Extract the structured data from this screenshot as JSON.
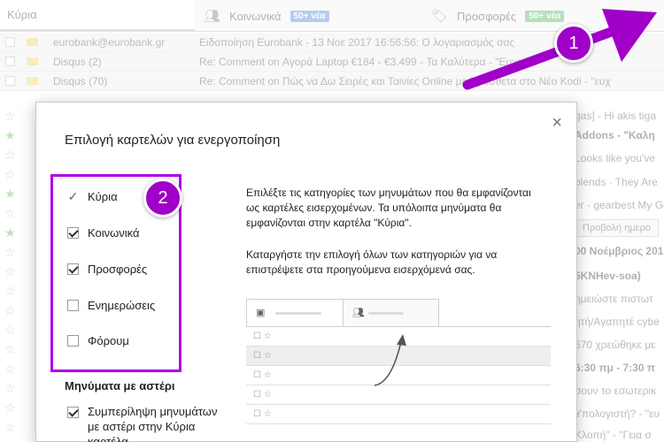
{
  "inbox": {
    "tabs": [
      {
        "label": "Κύρια",
        "badge": ""
      },
      {
        "label": "Κοινωνικά",
        "badge": "50+ νέα"
      },
      {
        "label": "Προσφορές",
        "badge": "50+ νέα"
      }
    ],
    "add_tab": "+",
    "rows": [
      {
        "sender": "eurobank@eurobank.gr",
        "subject": "Ειδοποίηση Eurobank - 13 Νοε 2017 16:56:56: Ο λογαριασμός σας",
        "right": ""
      },
      {
        "sender": "Disqus (2)",
        "subject": "Re: Comment on Αγορά Laptop €184 - €3.499 - Τα Καλύτερα - \"Ευχαρισ",
        "right": ""
      },
      {
        "sender": "Disqus (70)",
        "subject": "Re: Comment on Πώς να Δω Σειρές και Ταινίες Online με Πρόσθετα στο Νέο Kodi - \"ευχ",
        "right": ""
      }
    ],
    "right_snippets": [
      {
        "text": "gas] - Hi akis tiga",
        "style": "normal"
      },
      {
        "text": "Addons - \"Καλη",
        "style": "bold"
      },
      {
        "text": "Looks like you've",
        "style": "normal"
      },
      {
        "text": "blends · They Are",
        "style": "normal"
      },
      {
        "text": "er - gearbest My Ge",
        "style": "normal"
      },
      {
        "text": "Προβολή ημερο",
        "style": "btn"
      },
      {
        "text": "00 Νοέμβριος 201",
        "style": "bold"
      },
      {
        "text": "5KNHev-soa)",
        "style": "bold"
      },
      {
        "text": "ημειώστε πιστωτ",
        "style": "normal"
      },
      {
        "text": "ητή/Αγαπητέ cybe",
        "style": "normal"
      },
      {
        "text": "670 χρεώθηκε με",
        "style": "normal"
      },
      {
        "text": "6:30 πμ - 7:30 π",
        "style": "bold"
      },
      {
        "text": "σουν το εσωτερικ",
        "style": "normal"
      },
      {
        "text": "Υπολογιστή? - \"ευ",
        "style": "normal"
      },
      {
        "text": "Κλοπή\" - \"Γεια σ",
        "style": "normal"
      }
    ]
  },
  "dialog": {
    "title": "Επιλογή καρτελών για ενεργοποίηση",
    "close": "×",
    "options": [
      {
        "label": "Κύρια",
        "state": "fixed"
      },
      {
        "label": "Κοινωνικά",
        "state": "checked"
      },
      {
        "label": "Προσφορές",
        "state": "checked"
      },
      {
        "label": "Ενημερώσεις",
        "state": "unchecked"
      },
      {
        "label": "Φόρουμ",
        "state": "unchecked"
      }
    ],
    "starred_heading": "Μηνύματα με αστέρι",
    "starred_option": "Συμπερίληψη μηνυμάτων με αστέρι στην Κύρια καρτέλα",
    "description_1": "Επιλέξτε τις κατηγορίες των μηνυμάτων που θα εμφανίζονται ως καρτέλες εισερχομένων. Τα υπόλοιπα μηνύματα θα εμφανίζονται στην καρτέλα \"Κύρια\".",
    "description_2": "Καταργήστε την επιλογή όλων των κατηγοριών για να επιστρέψετε στα προηγούμενα εισερχόμενά σας.",
    "preview_row_glyph": "☐ ☆"
  },
  "annotations": {
    "marker_1": "1",
    "marker_2": "2",
    "accent_color": "#b100e8"
  }
}
